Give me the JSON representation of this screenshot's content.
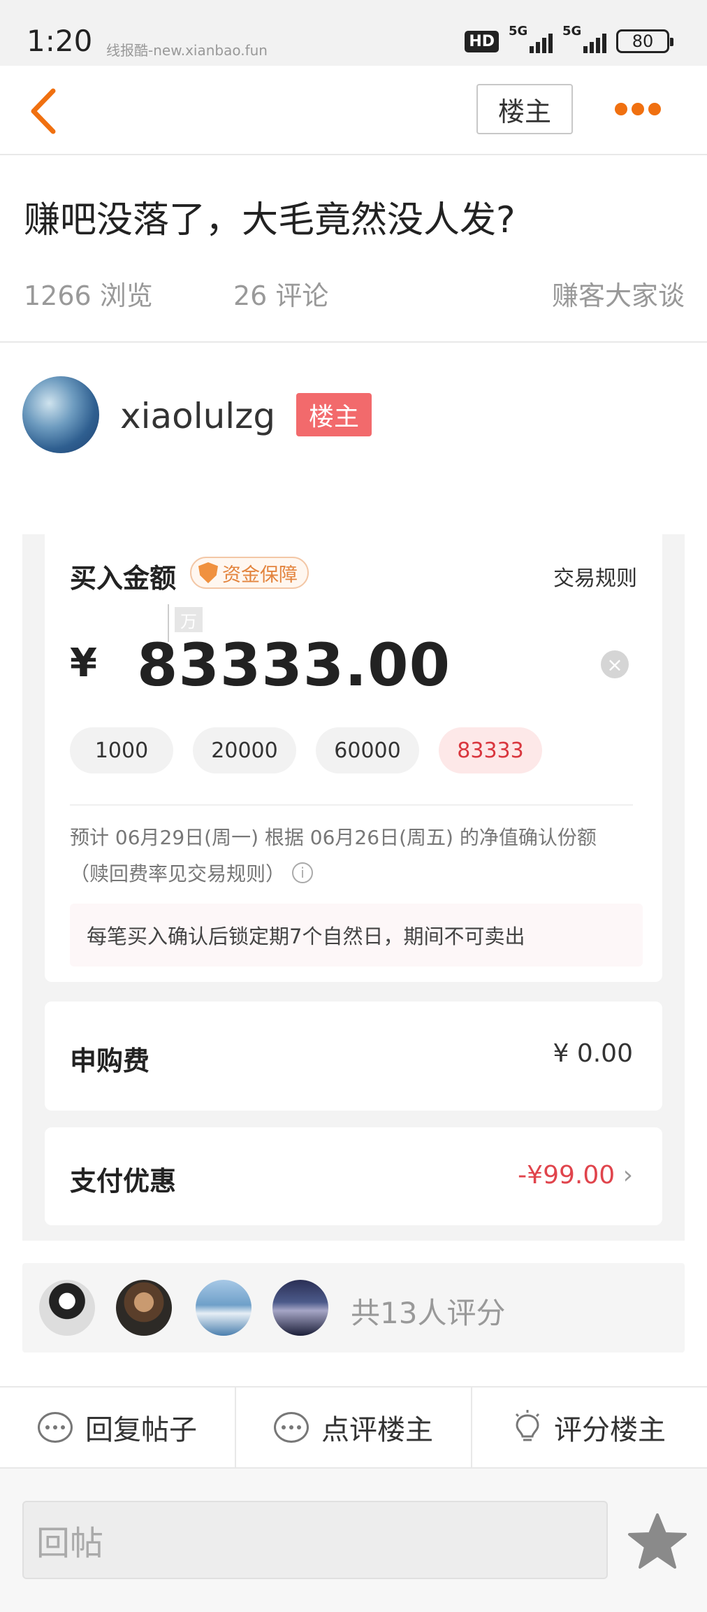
{
  "status_bar": {
    "time": "1:20",
    "source": "线报酷-new.xianbao.fun",
    "hd_label": "HD",
    "network1": "5G",
    "network2": "5G",
    "battery": "80"
  },
  "nav": {
    "owner_button": "楼主"
  },
  "post": {
    "title": "赚吧没落了，大毛竟然没人发?",
    "views": "1266 浏览",
    "comments": "26 评论",
    "category": "赚客大家谈"
  },
  "author": {
    "name": "xiaolulzg",
    "tag": "楼主"
  },
  "screenshot": {
    "buy_label": "买入金额",
    "guarantee": "资金保障",
    "trade_rules": "交易规则",
    "wan_unit": "万",
    "currency": "¥",
    "amount": "83333.00",
    "chips": [
      "1000",
      "20000",
      "60000",
      "83333"
    ],
    "selected_chip_index": 3,
    "estimate_line1": "预计 06月29日(周一) 根据 06月26日(周五) 的净值确认份额",
    "estimate_line2": "（赎回费率见交易规则）",
    "lock_note": "每笔买入确认后锁定期7个自然日，期间不可卖出",
    "fee_label": "申购费",
    "fee_value": "¥ 0.00",
    "discount_label": "支付优惠",
    "discount_value": "-¥99.00",
    "accent_red": "#e0444c"
  },
  "raters": {
    "text": "共13人评分"
  },
  "actions": [
    {
      "label": "回复帖子",
      "icon": "comment-bubble-icon"
    },
    {
      "label": "点评楼主",
      "icon": "comment-bubble-icon"
    },
    {
      "label": "评分楼主",
      "icon": "lightbulb-icon"
    }
  ],
  "reply": {
    "placeholder": "回帖"
  },
  "colors": {
    "accent_orange": "#f07010",
    "owner_tag": "#f26a6c"
  }
}
